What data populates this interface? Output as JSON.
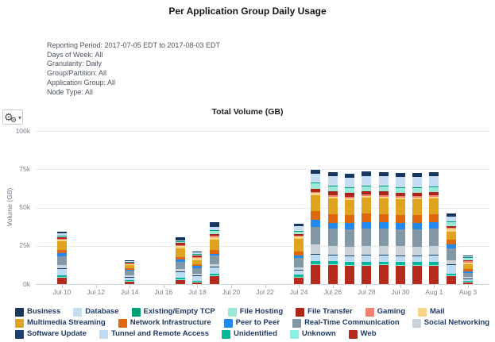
{
  "report": {
    "title": "Per Application Group Daily Usage",
    "filters": [
      "Reporting Period: 2017-07-05 EDT to 2017-08-03 EDT",
      "Days of Week: All",
      "Granularity: Daily",
      "Group/Partition: All",
      "Application Group: All",
      "Node Type: All"
    ]
  },
  "toolbar": {
    "gear_glyph": "⚙",
    "small_gear_glyph": "⚙",
    "caret_glyph": "▾"
  },
  "chart": {
    "title": "Total Volume (GB)",
    "ylabel": "Volume (GB)"
  },
  "chart_data": {
    "type": "bar",
    "stacked": true,
    "title": "Total Volume (GB)",
    "ylabel": "Volume (GB)",
    "values_unit": "thousand GB",
    "ylim_k": [
      0,
      100
    ],
    "ytick_values_k": [
      0,
      25,
      50,
      75,
      100
    ],
    "ytick_labels": [
      "0k",
      "25k",
      "50k",
      "75k",
      "100k"
    ],
    "xtick_every": 2,
    "grid": true,
    "legend_position": "bottom",
    "stacking_note": "stacked bottom-to-top in reverse of series order (Web at bottom, Business on top)",
    "x": [
      "Jul 10",
      "Jul 11",
      "Jul 12",
      "Jul 13",
      "Jul 14",
      "Jul 15",
      "Jul 16",
      "Jul 17",
      "Jul 18",
      "Jul 19",
      "Jul 20",
      "Jul 21",
      "Jul 22",
      "Jul 23",
      "Jul 24",
      "Jul 25",
      "Jul 26",
      "Jul 27",
      "Jul 28",
      "Jul 29",
      "Jul 30",
      "Jul 31",
      "Aug 1",
      "Aug 2",
      "Aug 3"
    ],
    "series": [
      {
        "name": "Business",
        "color": "#17375e",
        "values": [
          1.0,
          0,
          0,
          0,
          0.2,
          0,
          0,
          1.8,
          0.8,
          3.0,
          0,
          0,
          0,
          0,
          1.5,
          2.5,
          2.5,
          2.5,
          2.8,
          2.7,
          2.7,
          2.7,
          2.7,
          1.9,
          0.3
        ]
      },
      {
        "name": "Database",
        "color": "#c6dcf3",
        "values": [
          1.5,
          0,
          0,
          0,
          0.6,
          0,
          0,
          0.8,
          0.8,
          2.5,
          0,
          0,
          0,
          0,
          3.2,
          5.9,
          6.4,
          6.5,
          6.3,
          6.3,
          6.4,
          6.6,
          6.4,
          3.3,
          0.6
        ]
      },
      {
        "name": "Existing/Empty TCP",
        "color": "#00a077",
        "values": [
          0.2,
          0,
          0,
          0,
          0.1,
          0,
          0,
          0.2,
          0.3,
          0.4,
          0,
          0,
          0,
          0,
          0.4,
          0.4,
          0.4,
          0.4,
          0.4,
          0.4,
          0.4,
          0.4,
          0.4,
          0.3,
          0.1
        ]
      },
      {
        "name": "File Hosting",
        "color": "#9ae9d8",
        "values": [
          0.8,
          0,
          0,
          0,
          0.5,
          0,
          0,
          0.6,
          1.2,
          1.8,
          0,
          0,
          0,
          0,
          1.7,
          3.4,
          3.3,
          3.2,
          3.2,
          3.2,
          3.2,
          3.2,
          3.2,
          2.8,
          1.8
        ]
      },
      {
        "name": "File Transfer",
        "color": "#ad2418",
        "values": [
          0.8,
          0,
          0,
          0,
          0.4,
          0,
          0,
          1.5,
          1.0,
          1.2,
          0,
          0,
          0,
          0,
          1.0,
          2.3,
          2.5,
          2.2,
          2.3,
          2.3,
          2.2,
          2.2,
          2.2,
          0.7,
          0.7
        ]
      },
      {
        "name": "Gaming",
        "color": "#f28173",
        "values": [
          0.6,
          0,
          0,
          0,
          0.3,
          0,
          0,
          0.8,
          0.5,
          1.2,
          0,
          0,
          0,
          0,
          0.8,
          0.5,
          0.8,
          1.0,
          0.8,
          0.9,
          0.9,
          0.9,
          0.9,
          0.9,
          0.9
        ]
      },
      {
        "name": "Mail",
        "color": "#f6d488",
        "values": [
          1.3,
          0,
          0,
          0,
          0.9,
          0,
          0,
          1.5,
          1.2,
          1.5,
          0,
          0,
          0,
          0,
          1.6,
          1.3,
          1.0,
          1.2,
          1.2,
          1.1,
          1.1,
          1.1,
          1.1,
          1.7,
          1.2
        ]
      },
      {
        "name": "Multimedia Streaming",
        "color": "#dfa31f",
        "values": [
          5.5,
          0,
          0,
          0,
          2.2,
          0,
          0,
          5.5,
          2.8,
          6.5,
          0,
          0,
          0,
          0,
          8.0,
          10.5,
          10.5,
          10.0,
          10.5,
          10.4,
          10.3,
          10.3,
          10.4,
          5.2,
          3.2
        ]
      },
      {
        "name": "Network Infrastructure",
        "color": "#df670d",
        "values": [
          2.3,
          0,
          0,
          0,
          1.0,
          0,
          0,
          1.8,
          1.2,
          2.5,
          0,
          0,
          0,
          0,
          2.6,
          5.9,
          5.5,
          5.2,
          5.5,
          5.4,
          5.4,
          5.4,
          5.4,
          3.1,
          1.6
        ]
      },
      {
        "name": "Peer to Peer",
        "color": "#2189f0",
        "values": [
          1.8,
          0,
          0,
          0,
          0.7,
          0,
          0,
          1.5,
          1.2,
          1.5,
          0,
          0,
          0,
          0,
          1.4,
          4.5,
          4.0,
          4.2,
          4.0,
          4.1,
          4.0,
          4.0,
          4.0,
          2.6,
          1.1
        ]
      },
      {
        "name": "Real-Time Communication",
        "color": "#8398a6",
        "values": [
          6.0,
          0,
          0,
          0,
          3.0,
          0,
          0,
          4.5,
          3.8,
          5.5,
          0,
          0,
          0,
          0,
          6.5,
          11.6,
          11.0,
          11.0,
          11.5,
          11.2,
          11.2,
          11.2,
          11.3,
          7.8,
          2.2
        ]
      },
      {
        "name": "Social Networking",
        "color": "#cbd2d8",
        "values": [
          1.8,
          0,
          0,
          0,
          0.8,
          0,
          0,
          1.5,
          1.2,
          1.5,
          0,
          0,
          0,
          0,
          1.6,
          6.1,
          6.0,
          5.8,
          6.0,
          5.9,
          5.9,
          5.9,
          6.0,
          2.6,
          1.3
        ]
      },
      {
        "name": "Software Update",
        "color": "#1a406f",
        "values": [
          0.2,
          0,
          0,
          0,
          0.1,
          0,
          0,
          0.1,
          0.1,
          0.2,
          0,
          0,
          0,
          0,
          0.2,
          0.3,
          0.3,
          0.3,
          0.3,
          0.3,
          0.3,
          0.3,
          0.3,
          0.2,
          0.1
        ]
      },
      {
        "name": "Tunnel and Remote Access",
        "color": "#bedbf4",
        "values": [
          4.5,
          0,
          0,
          0,
          2.2,
          0,
          0,
          4.5,
          3.2,
          4.5,
          0,
          0,
          0,
          0,
          3.0,
          4.2,
          4.0,
          4.2,
          4.0,
          4.1,
          4.0,
          4.0,
          4.1,
          6.0,
          1.4
        ]
      },
      {
        "name": "Unidentified",
        "color": "#00b69b",
        "values": [
          1.0,
          0,
          0,
          0,
          0.4,
          0,
          0,
          0.8,
          0.6,
          1.0,
          0,
          0,
          0,
          0,
          1.2,
          2.1,
          2.0,
          2.0,
          2.1,
          2.0,
          2.0,
          2.0,
          2.0,
          1.4,
          0.7
        ]
      },
      {
        "name": "Unknown",
        "color": "#86f2e2",
        "values": [
          0.2,
          0,
          0,
          0,
          0.1,
          0,
          0,
          0.1,
          0.1,
          0.2,
          0,
          0,
          0,
          0,
          0.3,
          0.3,
          0.3,
          0.3,
          0.3,
          0.3,
          0.3,
          0.3,
          0.3,
          0.2,
          0.1
        ]
      },
      {
        "name": "Web",
        "color": "#b52a1b",
        "values": [
          4.5,
          0,
          0,
          0,
          2.0,
          0,
          0,
          3.0,
          1.5,
          5.5,
          0,
          0,
          0,
          0,
          4.5,
          12.7,
          12.5,
          12.0,
          12.3,
          12.4,
          12.2,
          12.0,
          12.3,
          5.3,
          1.2
        ]
      }
    ]
  }
}
